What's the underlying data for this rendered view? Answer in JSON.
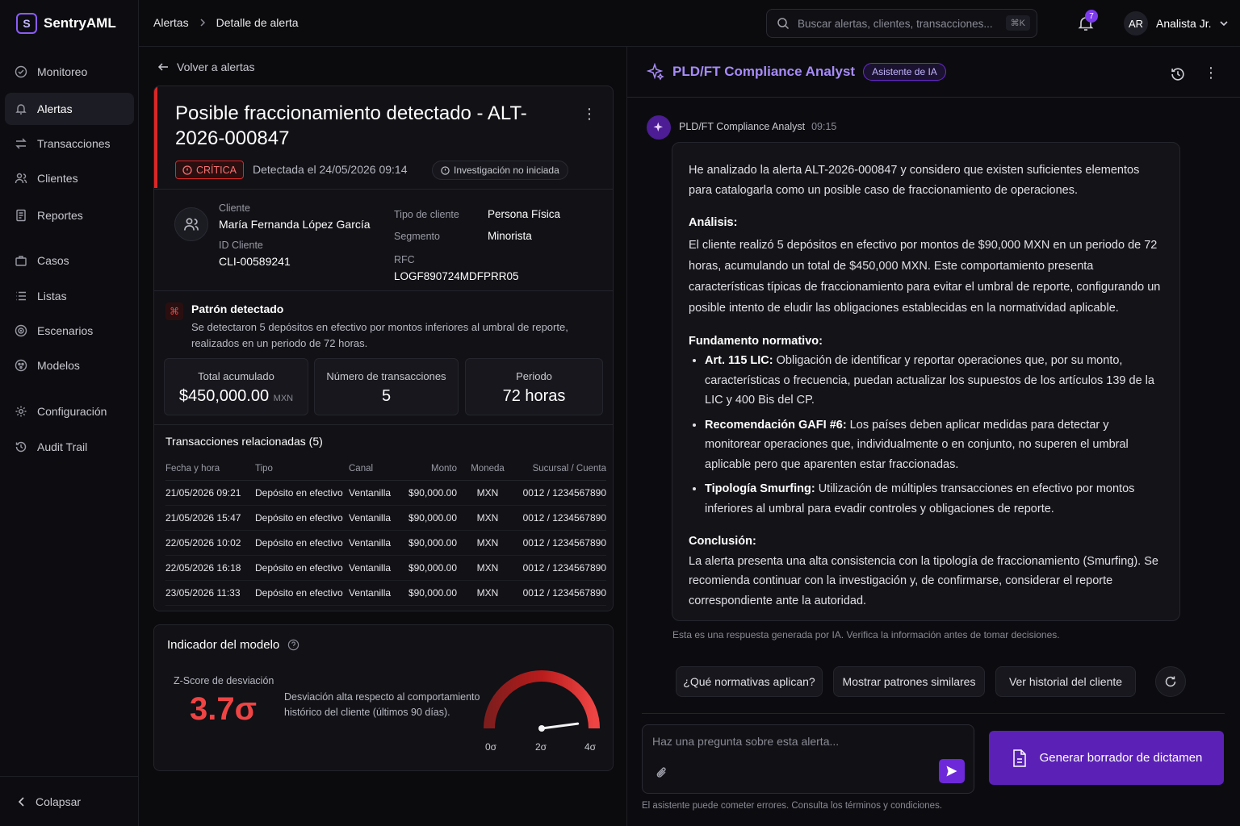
{
  "app": {
    "name": "SentryAML"
  },
  "sidebar": {
    "items": [
      {
        "label": "Monitoreo",
        "icon": "monitor-icon"
      },
      {
        "label": "Alertas",
        "icon": "bell-icon",
        "active": true
      },
      {
        "label": "Transacciones",
        "icon": "transfer-icon"
      },
      {
        "label": "Clientes",
        "icon": "users-icon"
      },
      {
        "label": "Reportes",
        "icon": "report-icon"
      },
      {
        "label": "Casos",
        "icon": "briefcase-icon"
      },
      {
        "label": "Listas",
        "icon": "list-icon"
      },
      {
        "label": "Escenarios",
        "icon": "target-icon"
      },
      {
        "label": "Modelos",
        "icon": "model-icon"
      },
      {
        "label": "Configuración",
        "icon": "gear-icon"
      },
      {
        "label": "Audit Trail",
        "icon": "history-icon"
      }
    ],
    "collapse_label": "Colapsar"
  },
  "topbar": {
    "breadcrumb": [
      "Alertas",
      "Detalle de alerta"
    ],
    "search_placeholder": "Buscar alertas, clientes, transacciones...",
    "search_shortcut": "⌘K",
    "notifications_count": "7",
    "user_initials": "AR",
    "user_name": "Analista Jr."
  },
  "alert": {
    "back_label": "Volver a alertas",
    "title": "Posible fraccionamiento detectado - ALT-2026-000847",
    "severity": "CRÍTICA",
    "detected": "Detectada el 24/05/2026 09:14",
    "status": "Investigación no iniciada",
    "client": {
      "client_label": "Cliente",
      "client_name": "María Fernanda López García",
      "id_label": "ID Cliente",
      "id": "CLI-00589241",
      "type_label": "Tipo de cliente",
      "type": "Persona Física",
      "segment_label": "Segmento",
      "segment": "Minorista",
      "rfc_label": "RFC",
      "rfc": "LOGF890724MDFPRR05"
    },
    "pattern": {
      "title": "Patrón detectado",
      "description": "Se detectaron 5 depósitos en efectivo por montos inferiores al umbral de reporte, realizados en un periodo de 72 horas."
    },
    "stats": [
      {
        "label": "Total acumulado",
        "value": "$450,000.00",
        "unit": "MXN"
      },
      {
        "label": "Número de transacciones",
        "value": "5"
      },
      {
        "label": "Periodo",
        "value": "72 horas"
      }
    ],
    "transactions": {
      "title": "Transacciones relacionadas (5)",
      "headers": [
        "Fecha y hora",
        "Tipo",
        "Canal",
        "Monto",
        "Moneda",
        "Sucursal / Cuenta"
      ],
      "rows": [
        [
          "21/05/2026 09:21",
          "Depósito en efectivo",
          "Ventanilla",
          "$90,000.00",
          "MXN",
          "0012 / 1234567890"
        ],
        [
          "21/05/2026 15:47",
          "Depósito en efectivo",
          "Ventanilla",
          "$90,000.00",
          "MXN",
          "0012 / 1234567890"
        ],
        [
          "22/05/2026 10:02",
          "Depósito en efectivo",
          "Ventanilla",
          "$90,000.00",
          "MXN",
          "0012 / 1234567890"
        ],
        [
          "22/05/2026 16:18",
          "Depósito en efectivo",
          "Ventanilla",
          "$90,000.00",
          "MXN",
          "0012 / 1234567890"
        ],
        [
          "23/05/2026 11:33",
          "Depósito en efectivo",
          "Ventanilla",
          "$90,000.00",
          "MXN",
          "0012 / 1234567890"
        ]
      ]
    },
    "model": {
      "title": "Indicador del modelo",
      "zscore_label": "Z-Score de desviación",
      "zscore": "3.7σ",
      "zscore_value": 3.7,
      "description": "Desviación alta respecto al comportamiento histórico del cliente (últimos 90 días).",
      "gauge_min": "0σ",
      "gauge_mid": "2σ",
      "gauge_max": "4σ",
      "gauge_range": [
        0,
        4
      ]
    }
  },
  "assistant": {
    "title": "PLD/FT Compliance Analyst",
    "badge": "Asistente de IA",
    "message": {
      "author": "PLD/FT Compliance Analyst",
      "time": "09:15",
      "intro": "He analizado la alerta ALT-2026-000847 y considero que existen suficientes elementos para catalogarla como un posible caso de fraccionamiento de operaciones.",
      "analysis_title": "Análisis:",
      "analysis": "El cliente realizó 5 depósitos en efectivo por montos de $90,000 MXN en un periodo de 72 horas, acumulando un total de $450,000 MXN. Este comportamiento presenta características típicas de fraccionamiento para evitar el umbral de reporte, configurando un posible intento de eludir las obligaciones establecidas en la normatividad aplicable.",
      "basis_title": "Fundamento normativo:",
      "basis": [
        {
          "term": "Art. 115 LIC:",
          "text": " Obligación de identificar y reportar operaciones que, por su monto, características o frecuencia, puedan actualizar los supuestos de los artículos 139 de la LIC y 400 Bis del CP."
        },
        {
          "term": "Recomendación GAFI #6:",
          "text": " Los países deben aplicar medidas para detectar y monitorear operaciones que, individualmente o en conjunto, no superen el umbral aplicable pero que aparenten estar fraccionadas."
        },
        {
          "term": "Tipología Smurfing:",
          "text": " Utilización de múltiples transacciones en efectivo por montos inferiores al umbral para evadir controles y obligaciones de reporte."
        }
      ],
      "conclusion_title": "Conclusión:",
      "conclusion": "La alerta presenta una alta consistencia con la tipología de fraccionamiento (Smurfing). Se recomienda continuar con la investigación y, de confirmarse, considerar el reporte correspondiente ante la autoridad."
    },
    "disclaimer": "Esta es una respuesta generada por IA. Verifica la información antes de tomar decisiones.",
    "suggestions": [
      "¿Qué normativas aplican?",
      "Mostrar patrones similares",
      "Ver historial del cliente"
    ],
    "input_placeholder": "Haz una pregunta sobre esta alerta...",
    "generate_label": "Generar borrador de dictamen",
    "footnote": "El asistente puede cometer errores. Consulta los términos y condiciones."
  },
  "colors": {
    "accent": "#7c3aed",
    "critical": "#dc2626",
    "background": "#0b0b0e"
  }
}
